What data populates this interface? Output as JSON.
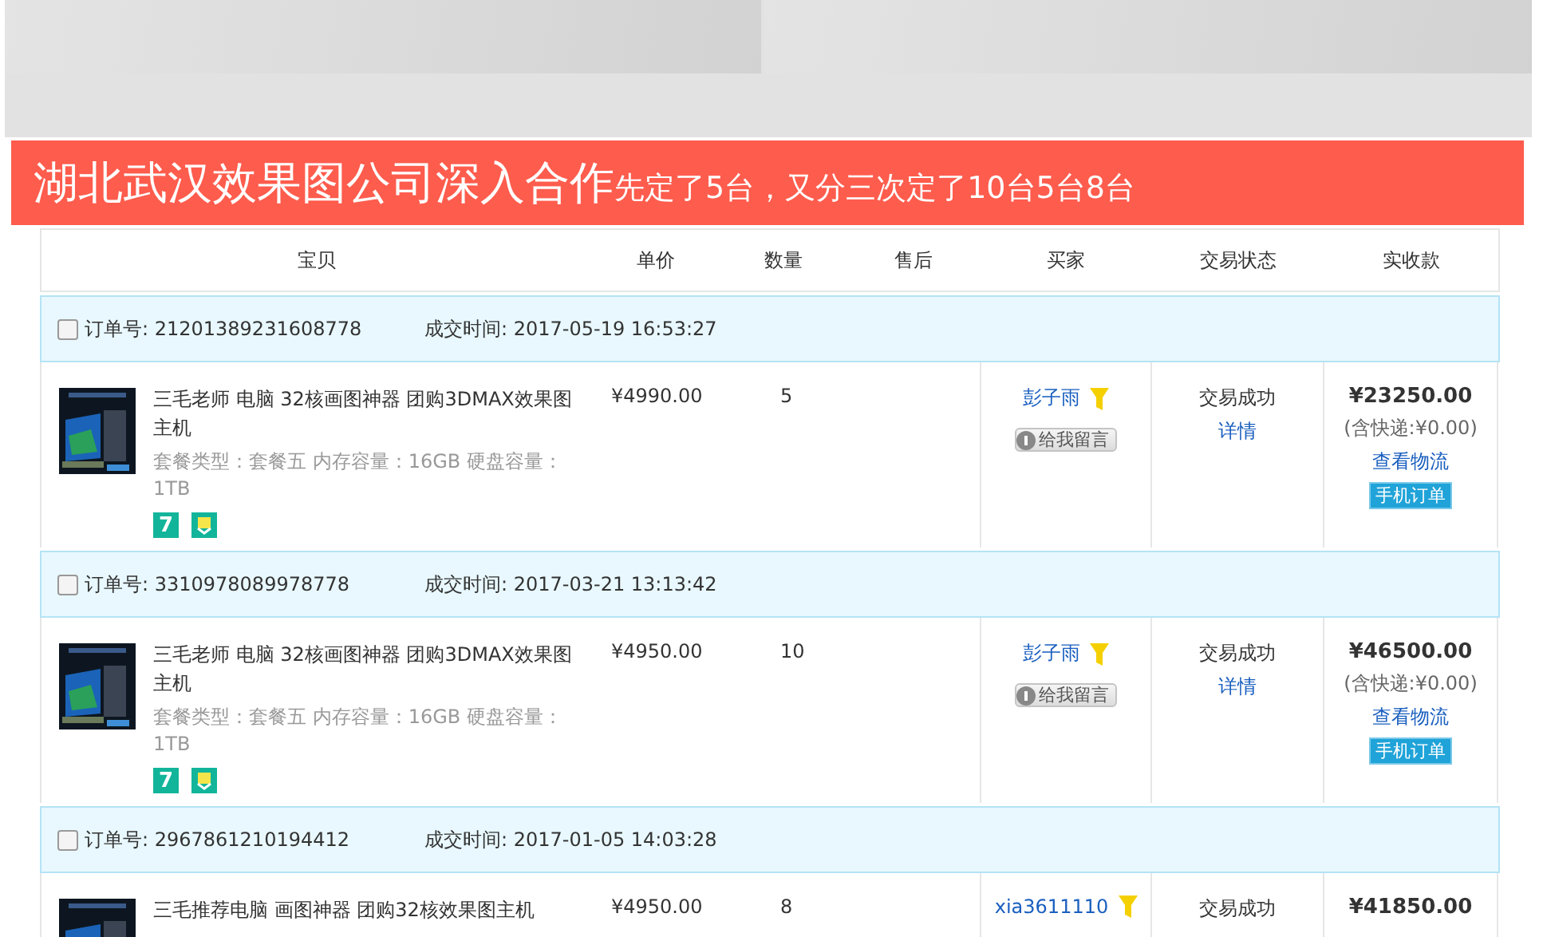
{
  "banner": {
    "headline": "湖北武汉效果图公司深入合作",
    "subline": "先定了5台，又分三次定了10台5台8台"
  },
  "table": {
    "columns": [
      "宝贝",
      "单价",
      "数量",
      "售后",
      "买家",
      "交易状态",
      "实收款"
    ],
    "orders": [
      {
        "checked": false,
        "order_no_label": "订单号:",
        "order_no": "21201389231608778",
        "time_label": "成交时间:",
        "time": "2017-05-19 16:53:27",
        "item": {
          "title": "三毛老师 电脑 32核画图神器 团购3DMAX效果图主机",
          "specs": "套餐类型：套餐五  内存容量：16GB  硬盘容量：1TB",
          "badges": [
            {
              "kind": "seven-day",
              "text": "7"
            },
            {
              "kind": "warranty"
            }
          ],
          "price": "¥4990.00",
          "quantity": "5",
          "buyer": "彭子雨",
          "buyer_flag": true,
          "message_button": "给我留言",
          "status": "交易成功",
          "details_link": "详情",
          "total": "¥23250.00",
          "shipping_note": "(含快递:¥0.00)",
          "logistics_link": "查看物流",
          "mobile_badge": "手机订单"
        }
      },
      {
        "checked": false,
        "order_no_label": "订单号:",
        "order_no": "3310978089978778",
        "time_label": "成交时间:",
        "time": "2017-03-21 13:13:42",
        "item": {
          "title": "三毛老师 电脑 32核画图神器 团购3DMAX效果图主机",
          "specs": "套餐类型：套餐五  内存容量：16GB  硬盘容量：1TB",
          "badges": [
            {
              "kind": "seven-day",
              "text": "7"
            },
            {
              "kind": "warranty"
            }
          ],
          "price": "¥4950.00",
          "quantity": "10",
          "buyer": "彭子雨",
          "buyer_flag": true,
          "message_button": "给我留言",
          "status": "交易成功",
          "details_link": "详情",
          "total": "¥46500.00",
          "shipping_note": "(含快递:¥0.00)",
          "logistics_link": "查看物流",
          "mobile_badge": "手机订单"
        }
      },
      {
        "checked": false,
        "order_no_label": "订单号:",
        "order_no": "2967861210194412",
        "time_label": "成交时间:",
        "time": "2017-01-05 14:03:28",
        "item": {
          "title": "三毛推荐电脑 画图神器 团购32核效果图主机",
          "price": "¥4950.00",
          "quantity": "8",
          "buyer": "xia3611110",
          "buyer_flag": true,
          "status": "交易成功",
          "total": "¥41850.00"
        }
      }
    ]
  }
}
